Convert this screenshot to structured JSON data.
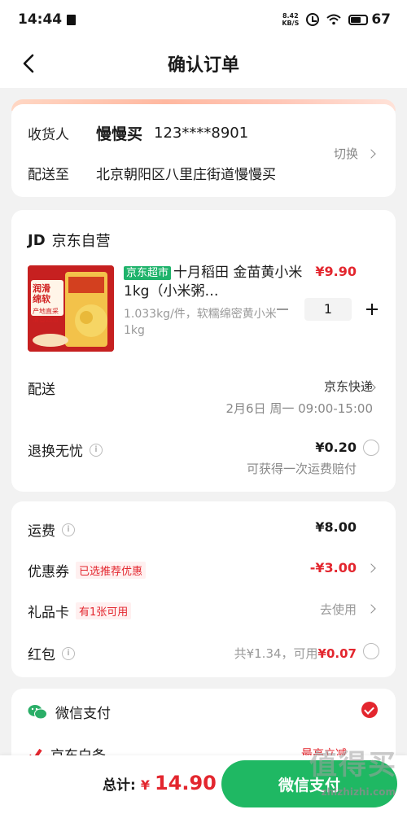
{
  "status_bar": {
    "time": "14:44",
    "net_speed": "8.42",
    "net_unit": "KB/S",
    "battery": "67"
  },
  "nav": {
    "title": "确认订单"
  },
  "address": {
    "receiver_label": "收货人",
    "receiver_name": "慢慢买",
    "phone": "123****8901",
    "deliver_label": "配送至",
    "address_text": "北京朝阳区八里庄街道慢慢买",
    "switch_label": "切换"
  },
  "shop": {
    "logo": "JD",
    "name": "京东自营"
  },
  "product": {
    "tag": "京东超市",
    "title": "十月稻田 金苗黄小米 1kg（小米粥…",
    "spec": "1.033kg/件，软糯绵密黄小米1kg",
    "price": "¥9.90",
    "quantity": "1",
    "image_text": [
      "润滑",
      "绵软",
      "产地直采",
      "清香四溢"
    ]
  },
  "delivery": {
    "label": "配送",
    "carrier": "京东快递",
    "time": "2月6日 周一 09:00-15:00"
  },
  "return_service": {
    "label": "退换无忧",
    "price": "¥0.20",
    "desc": "可获得一次运费赔付"
  },
  "fees": {
    "shipping_label": "运费",
    "shipping_value": "¥8.00",
    "coupon_label": "优惠券",
    "coupon_tag": "已选推荐优惠",
    "coupon_value": "-¥3.00",
    "giftcard_label": "礼品卡",
    "giftcard_tag": "有1张可用",
    "giftcard_value": "去使用",
    "redpacket_label": "红包",
    "redpacket_total": "共¥1.34，可用",
    "redpacket_usable": "¥0.07"
  },
  "payment": {
    "wechat_label": "微信支付",
    "jd_label": "京东白条",
    "jd_promo": "最高立减"
  },
  "bottom": {
    "total_label": "总计:",
    "currency": "¥",
    "total_amount": "14.90",
    "pay_button": "微信支付"
  },
  "watermark": {
    "main": "值得买",
    "sub": "zhizhizhi.com"
  },
  "colors": {
    "accent_red": "#e3262e",
    "wechat_green": "#1fb863"
  }
}
